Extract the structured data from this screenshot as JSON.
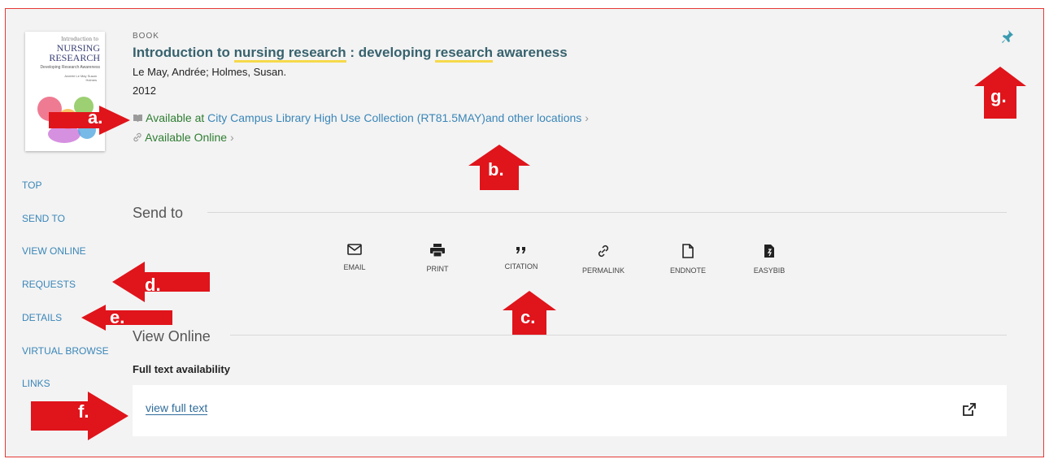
{
  "record": {
    "type": "BOOK",
    "title_parts": [
      "Introduction to ",
      "nursing research",
      " : developing ",
      "research",
      " awareness"
    ],
    "authors": "Le May, Andrée; Holmes, Susan.",
    "year": "2012",
    "availability_prefix": "Available at",
    "availability_location": "City Campus Library  High Use Collection (RT81.5MAY)and other locations",
    "available_online": "Available Online"
  },
  "cover": {
    "line1": "Introduction to",
    "title": "NURSING RESEARCH",
    "subtitle": "Developing Research Awareness",
    "authors": "Andrée Le May Susan Holmes"
  },
  "nav": [
    "TOP",
    "SEND TO",
    "VIEW ONLINE",
    "REQUESTS",
    "DETAILS",
    "VIRTUAL BROWSE",
    "LINKS"
  ],
  "send_to": {
    "heading": "Send to",
    "actions": [
      "EMAIL",
      "PRINT",
      "CITATION",
      "PERMALINK",
      "ENDNOTE",
      "EASYBIB"
    ]
  },
  "view_online": {
    "heading": "View Online",
    "full_text_label": "Full text availability",
    "link": "view full text"
  },
  "annotations": [
    "a.",
    "b.",
    "c.",
    "d.",
    "e.",
    "f.",
    "g."
  ],
  "colors": {
    "accent": "#3a86b8",
    "available": "#2e7d32",
    "annotation": "#e0141b",
    "highlight": "#f5d94a"
  }
}
